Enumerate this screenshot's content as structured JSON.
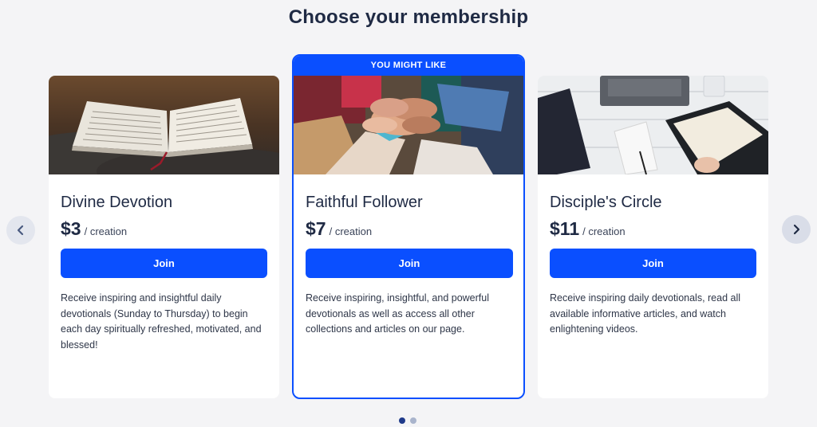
{
  "page": {
    "title": "Choose your membership"
  },
  "colors": {
    "accent": "#0a4fff",
    "text": "#1f2a44",
    "background": "#f4f4f6"
  },
  "carousel": {
    "prev_icon": "chevron-left-icon",
    "next_icon": "chevron-right-icon",
    "dots": [
      {
        "active": true
      },
      {
        "active": false
      }
    ]
  },
  "plans": [
    {
      "name": "Divine Devotion",
      "price": "$3",
      "per": "/ creation",
      "button": "Join",
      "image": "open-bible-photo",
      "description": "Receive inspiring and insightful daily devotionals (Sunday to Thursday) to begin each day spiritually refreshed, motivated, and blessed!"
    },
    {
      "badge": "YOU MIGHT LIKE",
      "name": "Faithful Follower",
      "price": "$7",
      "per": "/ creation",
      "button": "Join",
      "image": "stacked-hands-photo",
      "description": "Receive inspiring, insightful, and powerful devotionals as well as access all other collections and articles on our page."
    },
    {
      "name": "Disciple's Circle",
      "price": "$11",
      "per": "/ creation",
      "button": "Join",
      "image": "bible-and-tablet-photo",
      "description": "Receive inspiring daily devotionals, read all available informative articles, and watch enlightening videos."
    }
  ]
}
